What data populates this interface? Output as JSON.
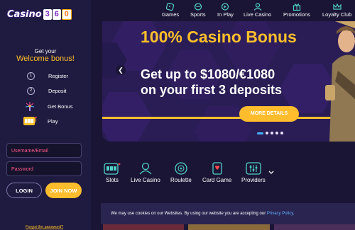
{
  "logo": {
    "word": "Casino",
    "digits": [
      "3",
      "6",
      "0"
    ]
  },
  "welcome": {
    "line1": "Get your",
    "line2": "Welcome bonus!"
  },
  "steps": [
    {
      "n": "1",
      "label": "Register"
    },
    {
      "n": "2",
      "label": "Deposit"
    },
    {
      "label": "Get Bonus",
      "icon": "fireworks-icon"
    },
    {
      "label": "Play",
      "icon": "slot-machine-icon"
    }
  ],
  "login": {
    "username_placeholder": "Username/Email",
    "password_placeholder": "Password",
    "login_label": "LOGIN",
    "join_label": "JOIN NOW",
    "forgot_label": "Forgot the password?"
  },
  "nav": [
    {
      "label": "Games",
      "icon": "dice-icon"
    },
    {
      "label": "Sports",
      "icon": "ball-icon"
    },
    {
      "label": "In Play",
      "icon": "play-icon"
    },
    {
      "label": "Live Casino",
      "icon": "dealer-icon"
    },
    {
      "label": "Promotions",
      "icon": "gift-icon"
    },
    {
      "label": "Loyalty Club",
      "icon": "crown-icon"
    }
  ],
  "banner": {
    "title": "100% Casino Bonus",
    "subtitle_line1": "Get up to $1080/€1080",
    "subtitle_line2": "on your first 3 deposits",
    "button": "MORE DETAILS",
    "slides": 5,
    "active_slide": 1
  },
  "categories": [
    {
      "label": "Slots",
      "icon": "slot-machine-icon"
    },
    {
      "label": "Live Casino",
      "icon": "dealer-icon"
    },
    {
      "label": "Roulette",
      "icon": "roulette-icon"
    },
    {
      "label": "Card Game",
      "icon": "card-icon"
    },
    {
      "label": "Providers",
      "icon": "providers-icon"
    }
  ],
  "cookie": {
    "text": "We may use cookies on our Websites. By using our website you are accepting our ",
    "link": "Privacy Policy",
    "end": "."
  },
  "colors": {
    "accent": "#ffbd2e",
    "bg": "#1b1535",
    "banner": "#2a1d56",
    "link": "#63b3ff"
  }
}
